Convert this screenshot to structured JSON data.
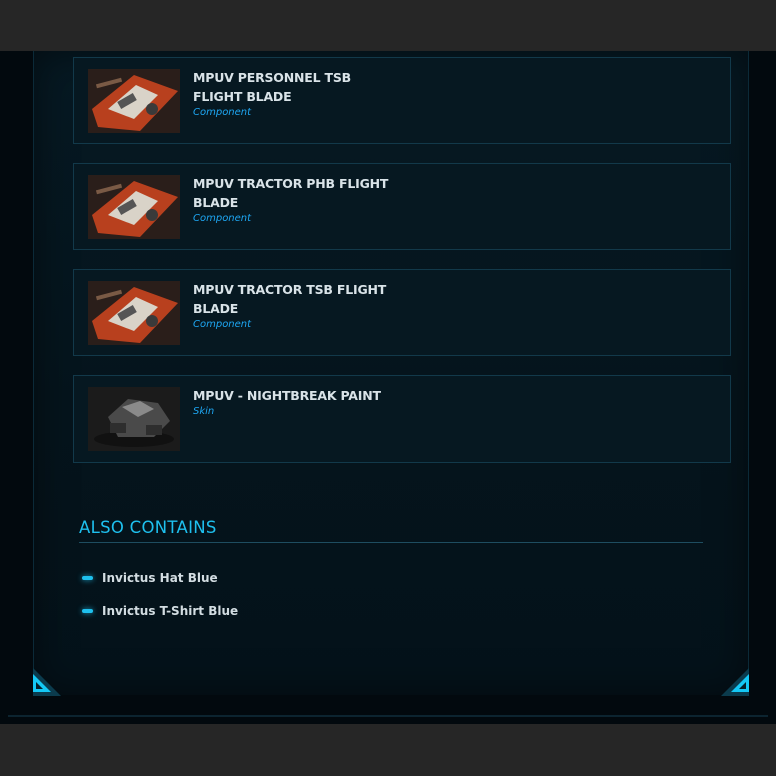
{
  "items": [
    {
      "title_line1": "MPUV PERSONNEL TSB",
      "title_line2": "FLIGHT BLADE",
      "type": "Component",
      "icon": "flight-blade-icon"
    },
    {
      "title_line1": "MPUV TRACTOR PHB FLIGHT",
      "title_line2": "BLADE",
      "type": "Component",
      "icon": "flight-blade-icon"
    },
    {
      "title_line1": "MPUV TRACTOR TSB FLIGHT",
      "title_line2": "BLADE",
      "type": "Component",
      "icon": "flight-blade-icon"
    },
    {
      "title_line1": "MPUV - NIGHTBREAK PAINT",
      "title_line2": "",
      "type": "Skin",
      "icon": "ship-paint-icon"
    }
  ],
  "also_contains": {
    "title": "ALSO CONTAINS",
    "items": [
      "Invictus Hat Blue",
      "Invictus T-Shirt Blue"
    ]
  },
  "colors": {
    "accent": "#1ec0ee",
    "type_label": "#1ea6f2",
    "card_border": "#12394a",
    "background": "#04121a"
  }
}
